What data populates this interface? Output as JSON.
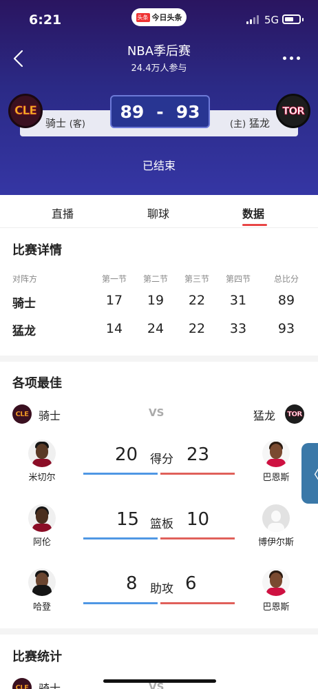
{
  "status_bar": {
    "time": "6:21",
    "app_badge": "头条",
    "app_name": "今日头条",
    "network": "5G"
  },
  "header": {
    "title": "NBA季后赛",
    "subtitle": "24.4万人参与",
    "game_status": "已结束"
  },
  "teams": {
    "away": {
      "logo_text": "CLE",
      "name": "骑士",
      "tag": "(客)",
      "score": "89"
    },
    "home": {
      "logo_text": "TOR",
      "name": "猛龙",
      "tag": "(主)",
      "score": "93"
    },
    "score_separator": "-"
  },
  "tabs": [
    {
      "label": "直播"
    },
    {
      "label": "聊球"
    },
    {
      "label": "数据",
      "active": true
    }
  ],
  "game_detail": {
    "title": "比赛详情",
    "headers": [
      "对阵方",
      "第一节",
      "第二节",
      "第三节",
      "第四节",
      "总比分"
    ],
    "rows": [
      {
        "team": "骑士",
        "values": [
          "17",
          "19",
          "22",
          "31",
          "89"
        ]
      },
      {
        "team": "猛龙",
        "values": [
          "14",
          "24",
          "22",
          "33",
          "93"
        ]
      }
    ]
  },
  "best": {
    "title": "各项最佳",
    "left_team": "骑士",
    "right_team": "猛龙",
    "vs": "VS",
    "left_logo": "CLE",
    "right_logo": "TOR",
    "stats": [
      {
        "label": "得分",
        "left_player": "米切尔",
        "left_value": "20",
        "right_player": "巴恩斯",
        "right_value": "23"
      },
      {
        "label": "篮板",
        "left_player": "阿伦",
        "left_value": "15",
        "right_player": "博伊尔斯",
        "right_value": "10"
      },
      {
        "label": "助攻",
        "left_player": "哈登",
        "left_value": "8",
        "right_player": "巴恩斯",
        "right_value": "6"
      }
    ]
  },
  "game_stats": {
    "title": "比赛统计",
    "team": "骑士",
    "vs": "VS"
  },
  "colors": {
    "accent": "#e84545",
    "away_bar": "#4f97e4",
    "home_bar": "#e0605a",
    "header_bg": "#2b2a86",
    "score_box": "#283592"
  }
}
